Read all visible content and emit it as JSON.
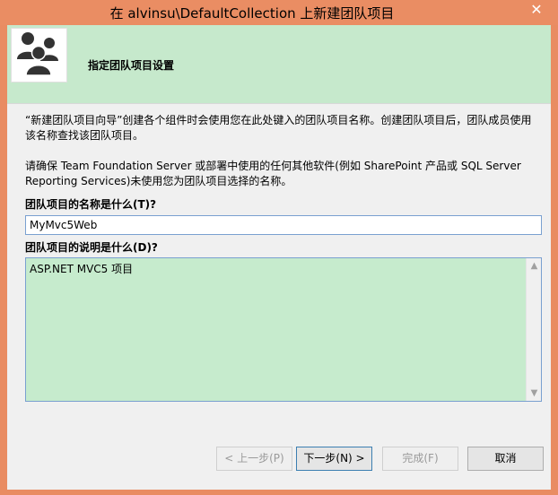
{
  "window": {
    "title": "在 alvinsu\\DefaultCollection 上新建团队项目",
    "close_glyph": "✕"
  },
  "header": {
    "title": "指定团队项目设置",
    "icon": "team-members-icon"
  },
  "intro": {
    "paragraph1": "“新建团队项目向导”创建各个组件时会使用您在此处键入的团队项目名称。创建团队项目后，团队成员使用该名称查找该团队项目。",
    "paragraph2": "请确保 Team Foundation Server 或部署中使用的任何其他软件(例如 SharePoint 产品或 SQL Server Reporting Services)未使用您为团队项目选择的名称。"
  },
  "form": {
    "name_label": "团队项目的名称是什么(T)?",
    "name_value": "MyMvc5Web",
    "description_label": "团队项目的说明是什么(D)?",
    "description_value": "ASP.NET MVC5 项目"
  },
  "buttons": {
    "prev": "< 上一步(P)",
    "next": "下一步(N) >",
    "finish": "完成(F)",
    "cancel": "取消"
  },
  "colors": {
    "header_bg": "#c6e9cc",
    "titlebar_bg": "#ea8d63",
    "description_bg": "#c6ebcd"
  }
}
